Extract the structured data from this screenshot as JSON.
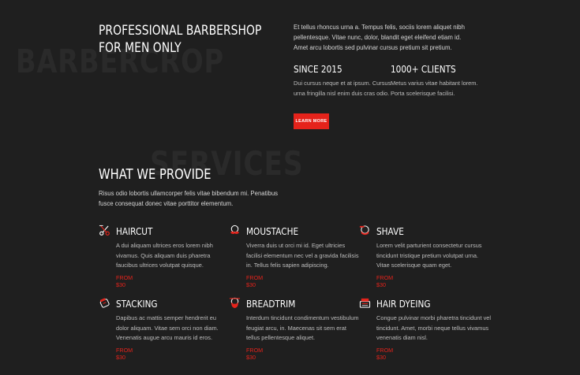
{
  "about": {
    "watermark": "BARBERCROP",
    "headline_line1": "PROFESSIONAL BARBERSHOP",
    "headline_line2": "FOR MEN ONLY",
    "intro_lines": [
      "Et tellus rhoncus urna a. Tempus felis, sociis lorem aliquet nibh",
      "pellentesque. Vitae nunc, dolor, blandit eget eleifend etiam id.",
      "Amet arcu lobortis sed pulvinar cursus pretium sit pretium."
    ],
    "stats": [
      {
        "title": "SINCE 2015",
        "lines": [
          "Dui cursus neque et at ipsum. Cursus",
          "urna fringilla nisl enim duis cras odio."
        ]
      },
      {
        "title": "1000+ CLIENTS",
        "lines": [
          "Metus varius vitae habitant lorem.",
          "Porta scelerisque facilisi."
        ]
      }
    ],
    "button_label": "LEARN MORE",
    "accent_color": "#e5231b"
  },
  "services": {
    "watermark": "SERVICES",
    "heading": "WHAT WE PROVIDE",
    "intro_lines": [
      "Risus odio lobortis ullamcorper felis vitae bibendum mi. Penatibus",
      "fusce consequat donec vitae porttitor elementum."
    ],
    "items": [
      {
        "icon": "scissors-comb-icon",
        "title": "HAIRCUT",
        "lines": [
          "A dui aliquam ultrices eros lorem nibh",
          "vivamus. Quis aliquam duis pharetra",
          "faucibus ultrices volutpat quisque."
        ],
        "price": "FROM $30"
      },
      {
        "icon": "moustache-face-icon",
        "title": "MOUSTACHE",
        "lines": [
          "Viverra duis ut orci mi id. Eget ultricies",
          "facilisi elementum nec vel a gravida facilisis",
          "in. Tellus felis sapien adipiscing."
        ],
        "price": "FROM $30"
      },
      {
        "icon": "shaving-face-icon",
        "title": "SHAVE",
        "lines": [
          "Lorem velit parturient consectetur cursus",
          "tincidunt tristique pretium volutpat urna.",
          "Vitae scelerisque quam eget."
        ],
        "price": "FROM $30"
      },
      {
        "icon": "trimmer-icon",
        "title": "STACKING",
        "lines": [
          "Dapibus ac mattis semper hendrerit eu",
          "dolor aliquam. Vitae sem orci non diam.",
          "Venenatis augue arcu mauris id eros."
        ],
        "price": "FROM $30"
      },
      {
        "icon": "beard-face-icon",
        "title": "BREADTRIM",
        "lines": [
          "Interdum tincidunt condimentum vestibulum",
          "feugiat arcu, in. Maecenas sit sem erat",
          "tellus pellentesque aliquet."
        ],
        "price": "FROM $30"
      },
      {
        "icon": "hair-dye-icon",
        "title": "HAIR DYEING",
        "lines": [
          "Congue pulvinar morbi pharetra tincidunt vel",
          "tincidunt. Amet, morbi neque tellus vivamus",
          "venenatis diam nisl."
        ],
        "price": "FROM $30"
      }
    ]
  }
}
